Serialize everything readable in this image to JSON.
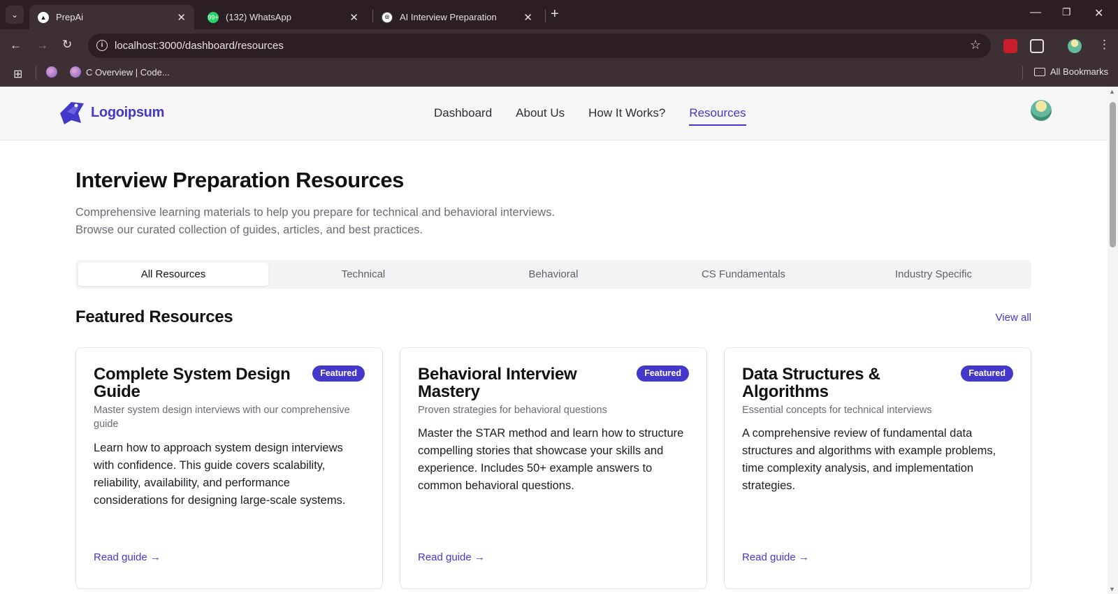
{
  "browser": {
    "tabs": [
      {
        "title": "PrepAi",
        "icon": "prepai-favicon",
        "active": true
      },
      {
        "title": "(132) WhatsApp",
        "icon": "whatsapp-favicon",
        "badge": "99+"
      },
      {
        "title": "AI Interview Preparation",
        "icon": "openai-favicon"
      }
    ],
    "url": "localhost:3000/dashboard/resources",
    "bookmarks": [
      {
        "label": ""
      },
      {
        "label": "C Overview | Code..."
      }
    ],
    "all_bookmarks_label": "All Bookmarks",
    "window_controls": {
      "minimize": "—",
      "maximize": "❐",
      "close": "✕"
    }
  },
  "site": {
    "logo_text": "Logoipsum",
    "nav": [
      {
        "label": "Dashboard",
        "active": false
      },
      {
        "label": "About Us",
        "active": false
      },
      {
        "label": "How It Works?",
        "active": false
      },
      {
        "label": "Resources",
        "active": true
      }
    ]
  },
  "main": {
    "title": "Interview Preparation Resources",
    "lede_line1": "Comprehensive learning materials to help you prepare for technical and behavioral interviews.",
    "lede_line2": "Browse our curated collection of guides, articles, and best practices.",
    "filter_tabs": [
      {
        "label": "All Resources",
        "active": true
      },
      {
        "label": "Technical",
        "active": false
      },
      {
        "label": "Behavioral",
        "active": false
      },
      {
        "label": "CS Fundamentals",
        "active": false
      },
      {
        "label": "Industry Specific",
        "active": false
      }
    ],
    "featured_heading": "Featured Resources",
    "view_all": "View all",
    "cards": [
      {
        "title": "Complete System Design Guide",
        "badge": "Featured",
        "subtitle": "Master system design interviews with our comprehensive guide",
        "body": "Learn how to approach system design interviews with confidence. This guide covers scalability, reliability, availability, and performance considerations for designing large-scale systems.",
        "link": "Read guide →"
      },
      {
        "title": "Behavioral Interview Mastery",
        "badge": "Featured",
        "subtitle": "Proven strategies for behavioral questions",
        "body": "Master the STAR method and learn how to structure compelling stories that showcase your skills and experience. Includes 50+ example answers to common behavioral questions.",
        "link": "Read guide →"
      },
      {
        "title": "Data Structures & Algorithms",
        "badge": "Featured",
        "subtitle": "Essential concepts for technical interviews",
        "body": "A comprehensive review of fundamental data structures and algorithms with example problems, time complexity analysis, and implementation strategies.",
        "link": "Read guide →"
      }
    ]
  },
  "colors": {
    "accent": "#4338ca",
    "chrome_dark": "#2b1f23",
    "chrome_mid": "#3d3035"
  }
}
